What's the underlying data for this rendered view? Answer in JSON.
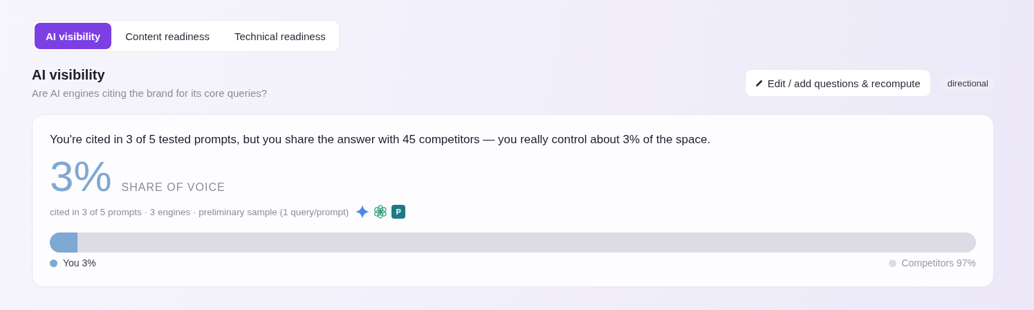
{
  "tabs": [
    {
      "label": "AI visibility",
      "selected": true
    },
    {
      "label": "Content readiness",
      "selected": false
    },
    {
      "label": "Technical readiness",
      "selected": false
    }
  ],
  "section": {
    "title": "AI visibility",
    "subtitle": "Are AI engines citing the brand for its core queries?",
    "action": "Edit / add questions & recompute",
    "badge": "directional"
  },
  "card": {
    "summary": "You're cited in 3 of 5 tested prompts, but you share the answer with 45 competitors — you really control about 3% of the space.",
    "metric": "3%",
    "metric_label": "SHARE OF VOICE",
    "detail": "cited in 3 of 5 prompts · 3 engines · preliminary sample (1 query/prompt)",
    "engines": [
      {
        "kind": "sparkle"
      },
      {
        "kind": "knot"
      },
      {
        "kind": "letter",
        "label": "P"
      }
    ],
    "bar": {
      "level": 0.03
    },
    "legend": [
      {
        "label": "You 3%",
        "color": "#7fa8d2"
      },
      {
        "label": "Competitors 97%",
        "color": "#dcdce4"
      }
    ]
  }
}
